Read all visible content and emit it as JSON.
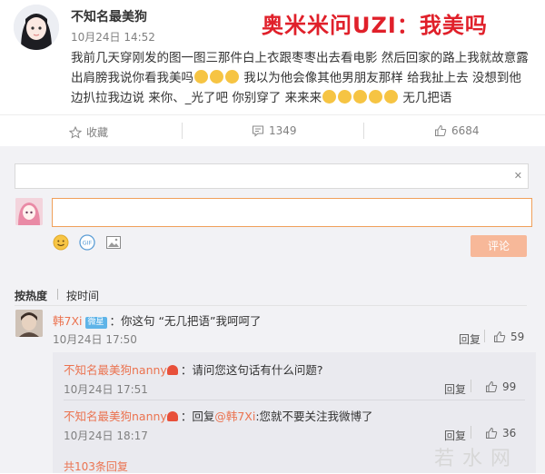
{
  "post": {
    "username": "不知名最美狗",
    "time": "10月24日 14:52",
    "overlay_title": "奥米米问UZI：我美吗",
    "text_a": "我前几天穿刚发的图一图三那件白上衣跟枣枣出去看电影 然后回家的路上我就故意露出肩膀我说你看我美吗",
    "text_b": " 我以为他会像其他男朋友那样 给我扯上去 没想到他边扒拉我边说 来你、_光了吧 你别穿了 来来来",
    "text_c": " 无几把语"
  },
  "actions": {
    "collect": "收藏",
    "comments_count": "1349",
    "likes_count": "6684"
  },
  "comment_box": {
    "submit_label": "评论",
    "input_value": ""
  },
  "sort": {
    "hot": "按热度",
    "time": "按时间"
  },
  "comments": [
    {
      "user": "韩7Xi",
      "badge": "微星",
      "text": "：你这句 “无几把语”我呵呵了",
      "time": "10月24日 17:50",
      "reply": "回复",
      "likes": "59"
    }
  ],
  "replies": [
    {
      "user": "不知名最美狗nanny",
      "text": "：请问您这句话有什么问题?",
      "time": "10月24日 17:51",
      "reply": "回复",
      "likes": "99"
    },
    {
      "user": "不知名最美狗nanny",
      "text_prefix": "：回复",
      "mention": "@韩7Xi",
      "text": ":您就不要关注我微博了",
      "time": "10月24日 18:17",
      "reply": "回复",
      "likes": "36"
    }
  ],
  "more_replies": "共103条回复",
  "watermark": "若水网",
  "colors": {
    "accent": "#eb7350",
    "overlay_red": "#e0202a",
    "panel": "#f2f2f5"
  }
}
